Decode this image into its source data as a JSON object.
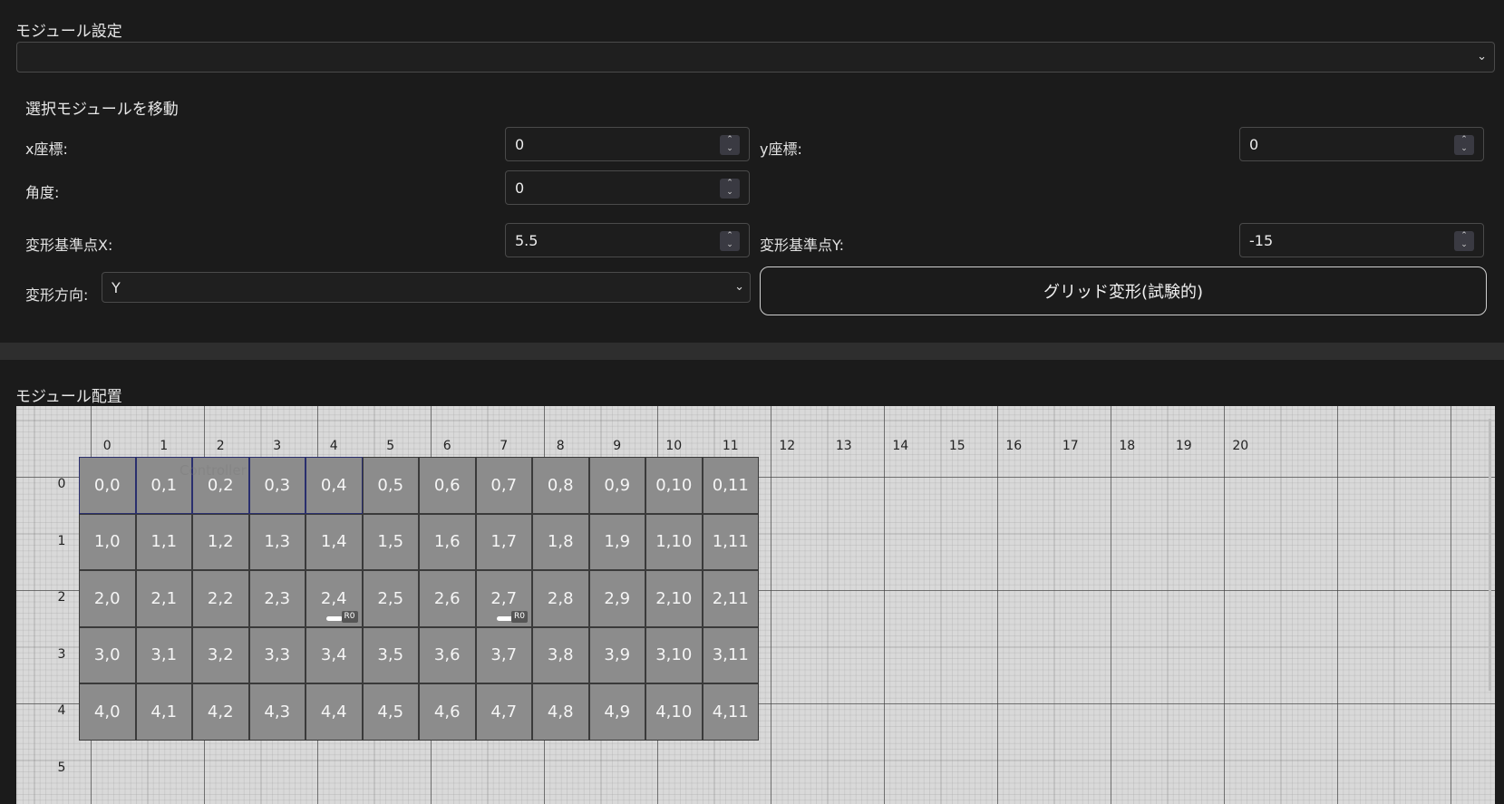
{
  "module_settings": {
    "title": "モジュール設定",
    "selected": ""
  },
  "move": {
    "title": "選択モジュールを移動",
    "x": {
      "label": "x座標:",
      "value": "0"
    },
    "y": {
      "label": "y座標:",
      "value": "0"
    },
    "angle": {
      "label": "角度:",
      "value": "0"
    },
    "pivot_x": {
      "label": "変形基準点X:",
      "value": "5.5"
    },
    "pivot_y": {
      "label": "変形基準点Y:",
      "value": "-15"
    },
    "direction": {
      "label": "変形方向:",
      "value": "Y"
    },
    "grid_button": "グリッド変形(試験的)"
  },
  "layout": {
    "title": "モジュール配置",
    "col_headers": [
      "0",
      "1",
      "2",
      "3",
      "4",
      "5",
      "6",
      "7",
      "8",
      "9",
      "10",
      "11",
      "12",
      "13",
      "14",
      "15",
      "16",
      "17",
      "18",
      "19",
      "20"
    ],
    "row_headers": [
      "0",
      "1",
      "2",
      "3",
      "4",
      "5"
    ],
    "ghost_text": "Controller",
    "badge_text": "R0",
    "cells": [
      [
        "0,0",
        "0,1",
        "0,2",
        "0,3",
        "0,4",
        "0,5",
        "0,6",
        "0,7",
        "0,8",
        "0,9",
        "0,10",
        "0,11"
      ],
      [
        "1,0",
        "1,1",
        "1,2",
        "1,3",
        "1,4",
        "1,5",
        "1,6",
        "1,7",
        "1,8",
        "1,9",
        "1,10",
        "1,11"
      ],
      [
        "2,0",
        "2,1",
        "2,2",
        "2,3",
        "2,4",
        "2,5",
        "2,6",
        "2,7",
        "2,8",
        "2,9",
        "2,10",
        "2,11"
      ],
      [
        "3,0",
        "3,1",
        "3,2",
        "3,3",
        "3,4",
        "3,5",
        "3,6",
        "3,7",
        "3,8",
        "3,9",
        "3,10",
        "3,11"
      ],
      [
        "4,0",
        "4,1",
        "4,2",
        "4,3",
        "4,4",
        "4,5",
        "4,6",
        "4,7",
        "4,8",
        "4,9",
        "4,10",
        "4,11"
      ]
    ],
    "selected_cells": [
      "0,0",
      "0,1",
      "0,2",
      "0,3",
      "0,4"
    ],
    "receiver_cells": [
      "2,4",
      "2,7"
    ]
  }
}
